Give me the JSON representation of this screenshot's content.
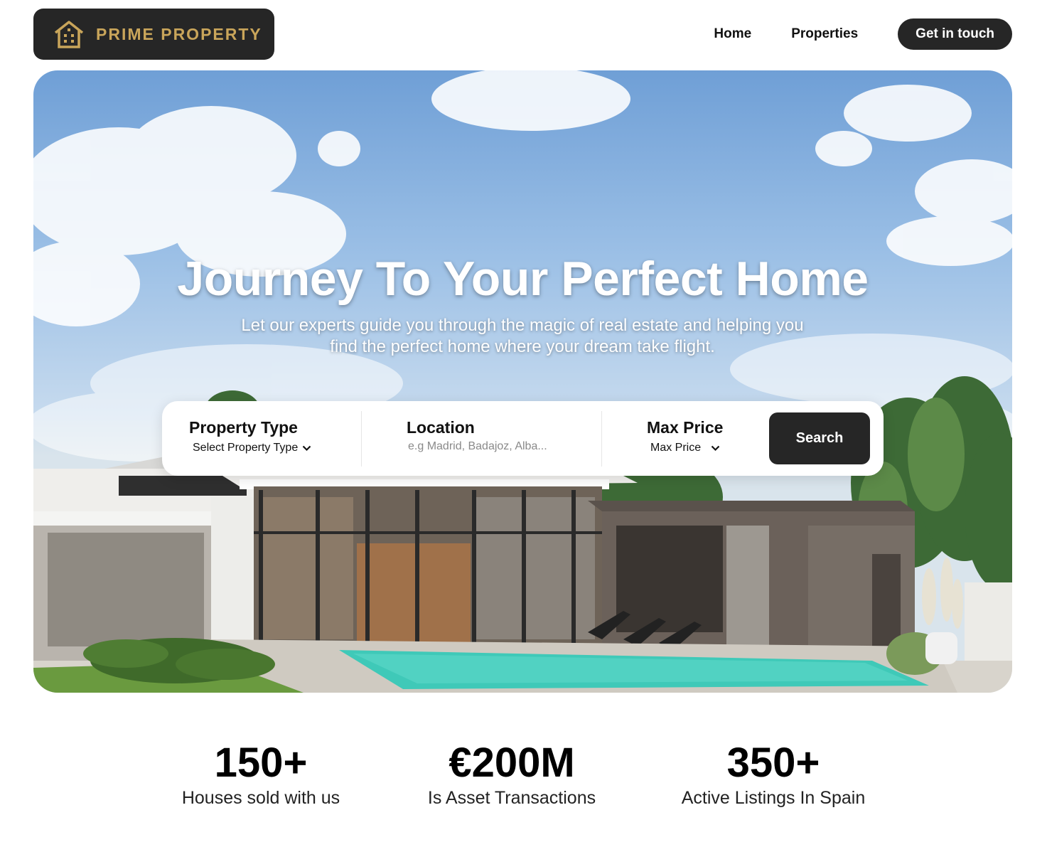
{
  "header": {
    "logo_text": "PRIME PROPERTY",
    "logo_icon": "house-icon",
    "nav": [
      {
        "label": "Home"
      },
      {
        "label": "Properties"
      }
    ],
    "cta_label": "Get in touch"
  },
  "hero": {
    "title": "Journey To Your Perfect Home",
    "subtitle": "Let our experts guide you through the magic of real estate and helping you find the perfect home where your dream take flight."
  },
  "search": {
    "property_type": {
      "title": "Property Type",
      "selected": "Select Property Type"
    },
    "location": {
      "title": "Location",
      "placeholder": "e.g Madrid, Badajoz, Alba..."
    },
    "max_price": {
      "title": "Max Price",
      "selected": "Max Price"
    },
    "button_label": "Search"
  },
  "stats": [
    {
      "value": "150+",
      "label": "Houses sold with us"
    },
    {
      "value": "€200M",
      "label": "Is Asset Transactions"
    },
    {
      "value": "350+",
      "label": "Active Listings In Spain"
    }
  ],
  "colors": {
    "brand_gold": "#c9a55a",
    "dark": "#262626",
    "pool": "#3fc9b8"
  }
}
